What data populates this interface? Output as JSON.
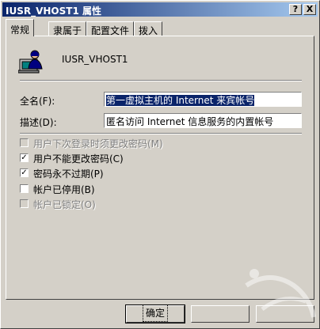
{
  "window": {
    "title": "IUSR_VHOST1 属性",
    "help_label": "?",
    "close_label": "X"
  },
  "tabs": [
    {
      "label": "常规"
    },
    {
      "label": "隶属于"
    },
    {
      "label": "配置文件"
    },
    {
      "label": "拨入"
    }
  ],
  "user": {
    "icon": "user-computer-icon",
    "name": "IUSR_VHOST1"
  },
  "form": {
    "fullname_label": "全名(F):",
    "fullname_value": "第一虚拟主机的 Internet 来宾帐号",
    "description_label": "描述(D):",
    "description_value": "匿名访问 Internet 信息服务的内置帐号"
  },
  "checkboxes": [
    {
      "label": "用户下次登录时须更改密码(M)",
      "checked": false,
      "disabled": true
    },
    {
      "label": "用户不能更改密码(C)",
      "checked": true,
      "disabled": false
    },
    {
      "label": "密码永不过期(P)",
      "checked": true,
      "disabled": false
    },
    {
      "label": "帐户已停用(B)",
      "checked": false,
      "disabled": false
    },
    {
      "label": "帐户已锁定(O)",
      "checked": false,
      "disabled": true
    }
  ],
  "buttons": {
    "ok_label": "确定"
  },
  "colors": {
    "titlebar_start": "#0a246a",
    "titlebar_end": "#a6caf0",
    "dialog_face": "#d4d0c8",
    "selection": "#0a246a"
  }
}
